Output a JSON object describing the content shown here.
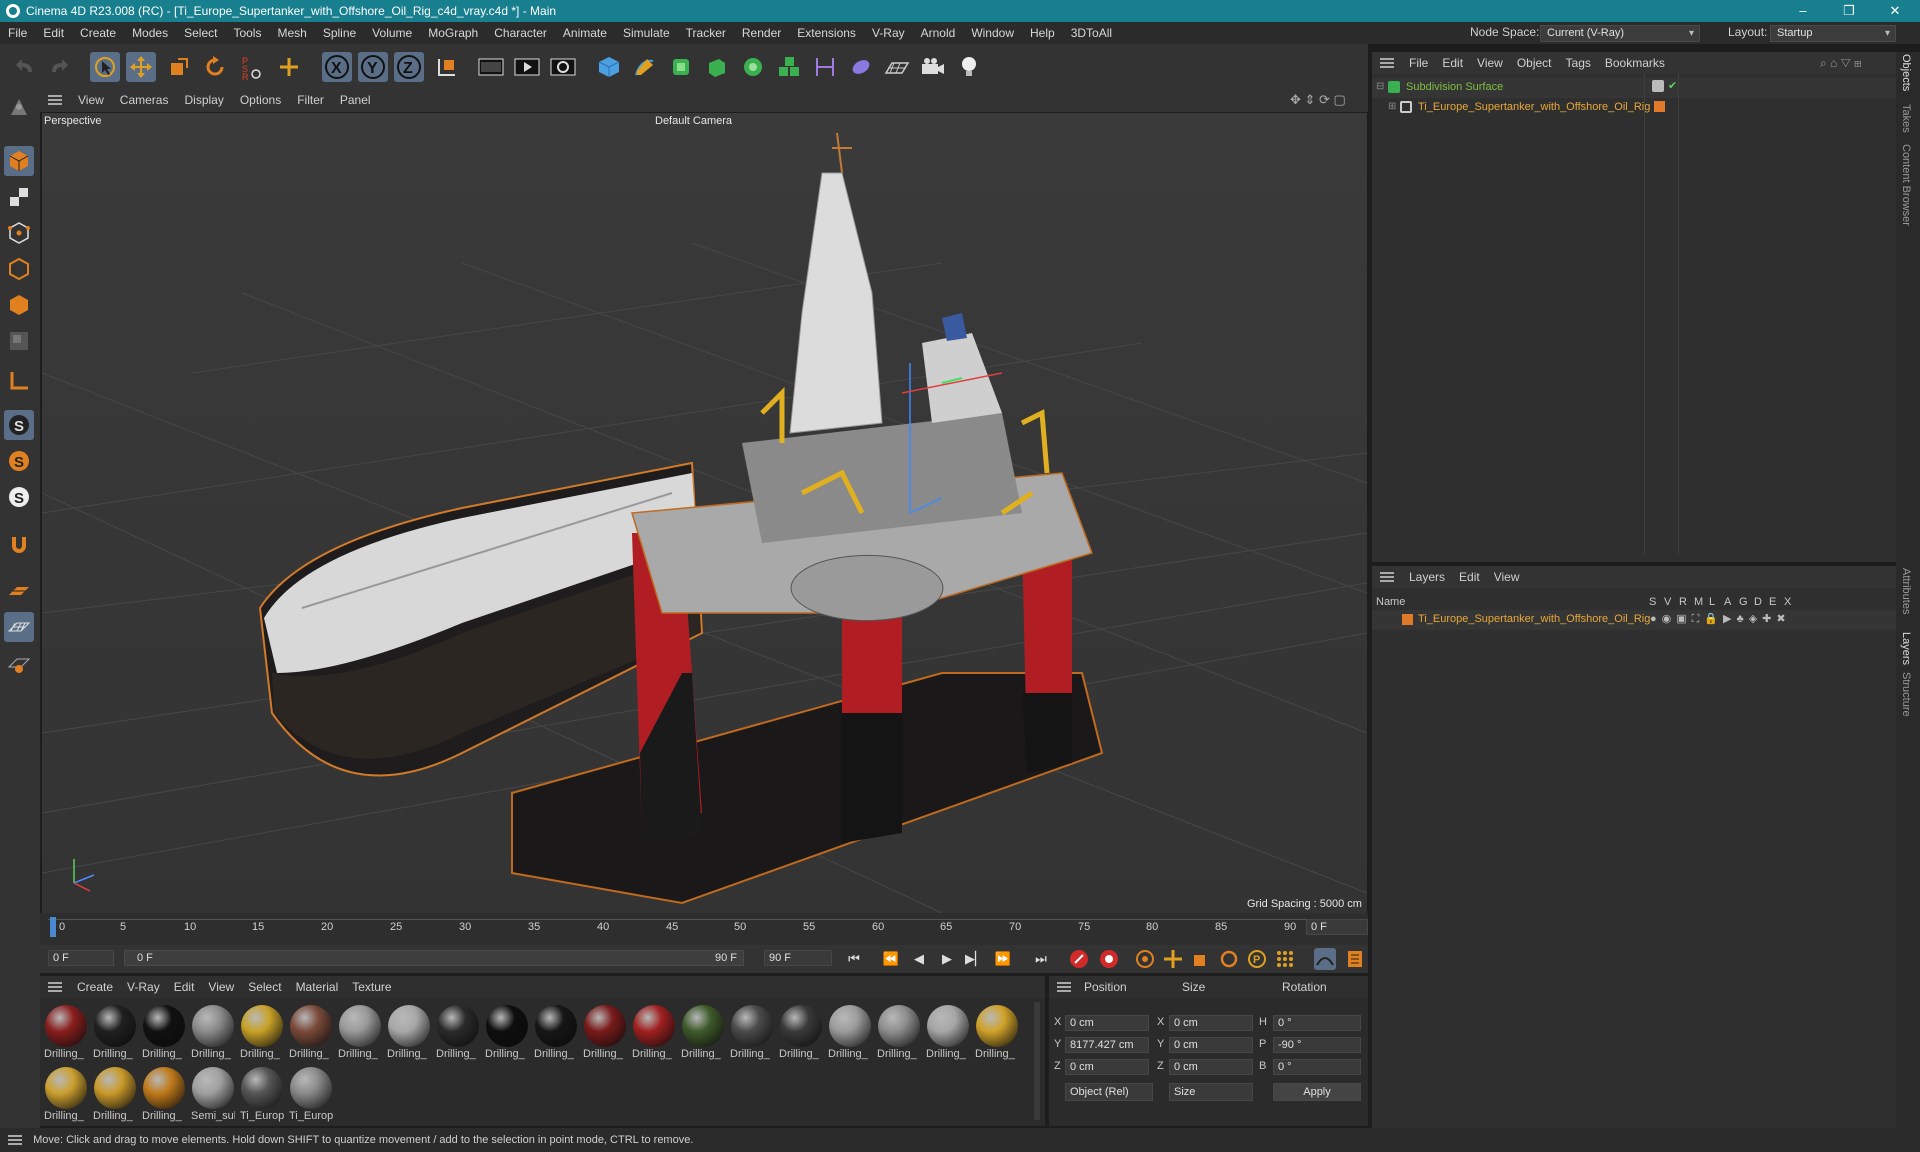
{
  "window": {
    "title": "Cinema 4D R23.008 (RC) - [Ti_Europe_Supertanker_with_Offshore_Oil_Rig_c4d_vray.c4d *] - Main",
    "minimize": "–",
    "restore": "❐",
    "close": "✕"
  },
  "menubar": {
    "items": [
      "File",
      "Edit",
      "Create",
      "Modes",
      "Select",
      "Tools",
      "Mesh",
      "Spline",
      "Volume",
      "MoGraph",
      "Character",
      "Animate",
      "Simulate",
      "Tracker",
      "Render",
      "Extensions",
      "V-Ray",
      "Arnold",
      "Window",
      "Help",
      "3DToAll"
    ],
    "node_space_label": "Node Space:",
    "node_space_value": "Current (V-Ray)",
    "layout_label": "Layout:",
    "layout_value": "Startup"
  },
  "toolbar": {
    "axis_x": "X",
    "axis_y": "Y",
    "axis_z": "Z"
  },
  "viewport": {
    "menu": [
      "View",
      "Cameras",
      "Display",
      "Options",
      "Filter",
      "Panel"
    ],
    "view_name": "Perspective",
    "camera": "Default Camera",
    "grid_spacing": "Grid Spacing : 5000 cm"
  },
  "timeline": {
    "ticks": [
      "0",
      "5",
      "10",
      "15",
      "20",
      "25",
      "30",
      "35",
      "40",
      "45",
      "50",
      "55",
      "60",
      "65",
      "70",
      "75",
      "80",
      "85",
      "90"
    ],
    "current_frame_right": "0 F",
    "start_field": "0 F",
    "range_start": "0 F",
    "range_end": "90 F",
    "end_field": "90 F"
  },
  "objects": {
    "menu": [
      "File",
      "Edit",
      "View",
      "Object",
      "Tags",
      "Bookmarks"
    ],
    "items": [
      {
        "name": "Subdivision Surface",
        "color": "#7fbf3f"
      },
      {
        "name": "Ti_Europe_Supertanker_with_Offshore_Oil_Rig",
        "color": "#e8a83a"
      }
    ]
  },
  "layers": {
    "menu": [
      "Layers",
      "Edit",
      "View"
    ],
    "header_name": "Name",
    "header_flags": [
      "S",
      "V",
      "R",
      "M",
      "L",
      "A",
      "G",
      "D",
      "E",
      "X"
    ],
    "items": [
      {
        "name": "Ti_Europe_Supertanker_with_Offshore_Oil_Rig",
        "color": "#e07a2a"
      }
    ]
  },
  "right_tabs": [
    "Objects",
    "Takes",
    "Content Browser",
    "Attributes",
    "Layers",
    "Structure"
  ],
  "materials": {
    "menu": [
      "Create",
      "V-Ray",
      "Edit",
      "View",
      "Select",
      "Material",
      "Texture"
    ],
    "row1": [
      {
        "label": "Drilling_",
        "color": "#8a1e1e"
      },
      {
        "label": "Drilling_",
        "color": "#202020"
      },
      {
        "label": "Drilling_",
        "color": "#111111"
      },
      {
        "label": "Drilling_",
        "color": "#8c8c8c"
      },
      {
        "label": "Drilling_",
        "color": "#c9a227"
      },
      {
        "label": "Drilling_",
        "color": "#7a4a3a"
      },
      {
        "label": "Drilling_",
        "color": "#9a9a9a"
      },
      {
        "label": "Drilling_",
        "color": "#a8a8a8"
      },
      {
        "label": "Drilling_",
        "color": "#2a2a2a"
      },
      {
        "label": "Drilling_",
        "color": "#0e0e0e"
      },
      {
        "label": "Drilling_",
        "color": "#161616"
      },
      {
        "label": "Drilling_",
        "color": "#7a1a1a"
      },
      {
        "label": "Drilling_",
        "color": "#a02020"
      },
      {
        "label": "Drilling_",
        "color": "#3e5a2a"
      },
      {
        "label": "Drilling_",
        "color": "#4a4a4a"
      },
      {
        "label": "Drilling_",
        "color": "#3a3a3a"
      },
      {
        "label": "Drilling_",
        "color": "#9c9c9c"
      },
      {
        "label": "Drilling_",
        "color": "#8e8e8e"
      },
      {
        "label": "Drilling_",
        "color": "#a6a6a6"
      },
      {
        "label": "Drilling_",
        "color": "#d0a22a"
      }
    ],
    "row2": [
      {
        "label": "Drilling_",
        "color": "#cca030"
      },
      {
        "label": "Drilling_",
        "color": "#c99a2a"
      },
      {
        "label": "Drilling_",
        "color": "#c07a1a"
      },
      {
        "label": "Semi_sul",
        "color": "#a0a0a0"
      },
      {
        "label": "Ti_Europ",
        "color": "#555555"
      },
      {
        "label": "Ti_Europ",
        "color": "#8a8a8a"
      }
    ]
  },
  "attributes": {
    "headers": [
      "Position",
      "Size",
      "Rotation"
    ],
    "rows": [
      {
        "axis": "X",
        "pos": "0 cm",
        "size_axis": "X",
        "size": "0 cm",
        "rot_axis": "H",
        "rot": "0 °"
      },
      {
        "axis": "Y",
        "pos": "8177.427 cm",
        "size_axis": "Y",
        "size": "0 cm",
        "rot_axis": "P",
        "rot": "-90 °"
      },
      {
        "axis": "Z",
        "pos": "0 cm",
        "size_axis": "Z",
        "size": "0 cm",
        "rot_axis": "B",
        "rot": "0 °"
      }
    ],
    "mode": "Object (Rel)",
    "size_mode": "Size",
    "apply": "Apply"
  },
  "status": "Move: Click and drag to move elements. Hold down SHIFT to quantize movement / add to the selection in point mode, CTRL to remove."
}
